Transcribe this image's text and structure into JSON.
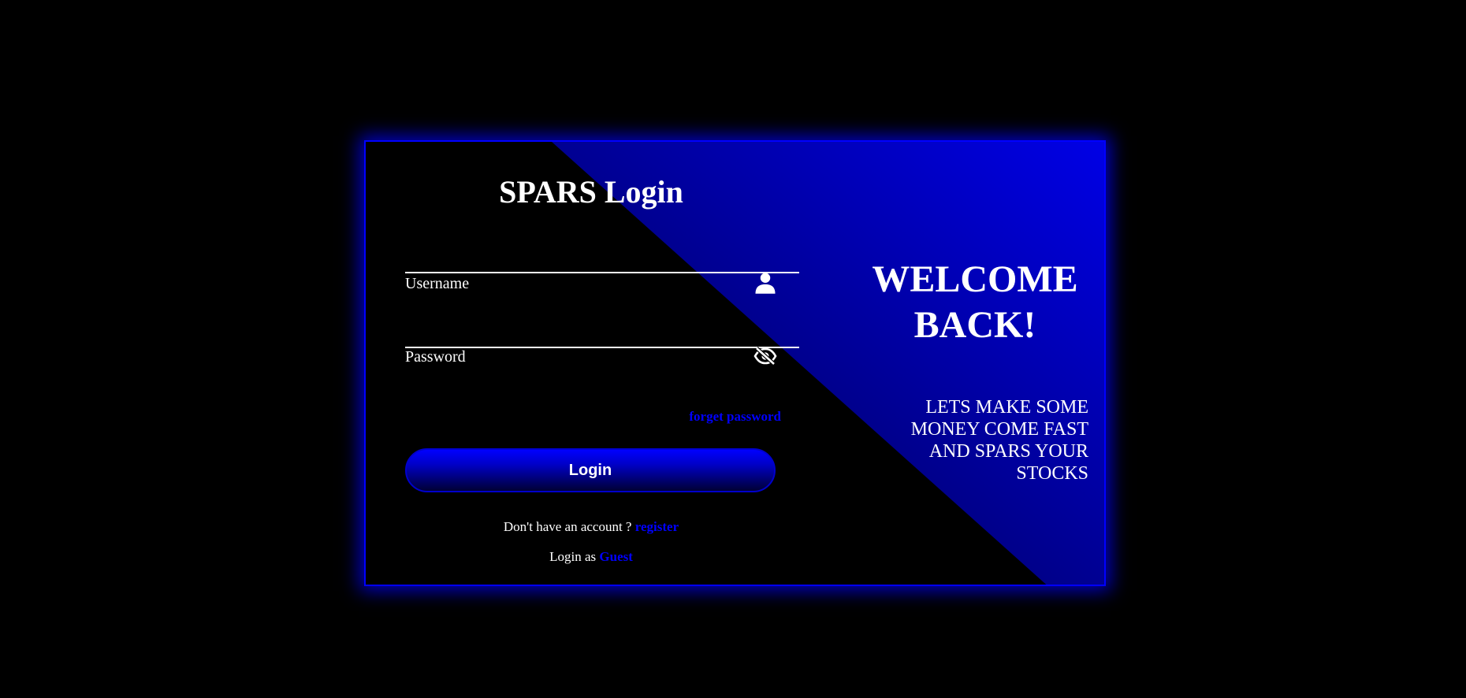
{
  "login": {
    "title": "SPARS Login",
    "username_label": "Username",
    "password_label": "Password",
    "forgot_label": "forget password",
    "button_label": "Login",
    "register_prompt": "Don't have an account ? ",
    "register_link": "register",
    "guest_prompt": "Login as ",
    "guest_link": "Guest"
  },
  "welcome": {
    "heading_line1": "WELCOME",
    "heading_line2": "BACK!",
    "tagline": "LETS MAKE SOME MONEY COME FAST AND SPARS YOUR STOCKS"
  },
  "icons": {
    "username": "user-icon",
    "password": "eye-slash-icon"
  },
  "colors": {
    "accent": "#0000ff",
    "background": "#000000",
    "text": "#ffffff"
  }
}
